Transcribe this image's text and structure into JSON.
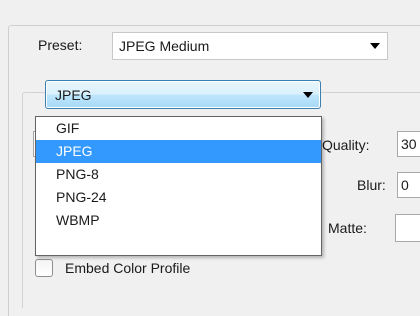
{
  "preset": {
    "label": "Preset:",
    "value": "JPEG Medium"
  },
  "format": {
    "value": "JPEG",
    "options": [
      {
        "label": "GIF",
        "selected": false
      },
      {
        "label": "JPEG",
        "selected": true
      },
      {
        "label": "PNG-8",
        "selected": false
      },
      {
        "label": "PNG-24",
        "selected": false
      },
      {
        "label": "WBMP",
        "selected": false
      }
    ]
  },
  "settings": {
    "quality_label": "Quality:",
    "quality_value": "30",
    "blur_label": "Blur:",
    "blur_value": "0",
    "matte_label": "Matte:",
    "embed_color_profile_label": "Embed Color Profile"
  },
  "colors": {
    "highlight": "#3399ff",
    "combo_focus_border": "#3c7fb1"
  }
}
